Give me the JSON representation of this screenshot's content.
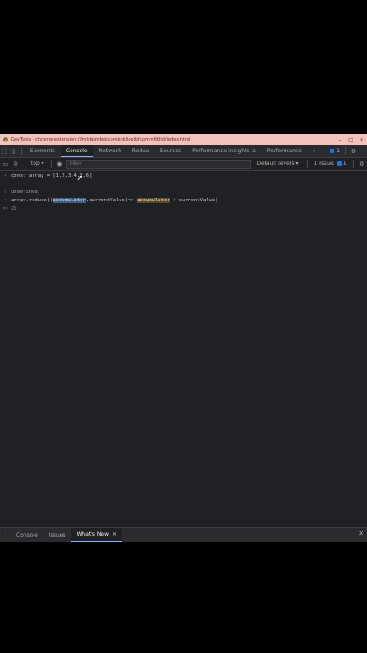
{
  "window": {
    "title": "DevTools - chrome-extension://lmhkpmbekcpmknklioeibfkpmmfibljd/index.html",
    "minimize": "–",
    "maximize": "□",
    "close": "✕"
  },
  "tabs": [
    {
      "label": "Elements"
    },
    {
      "label": "Console"
    },
    {
      "label": "Network"
    },
    {
      "label": "Redux"
    },
    {
      "label": "Sources"
    },
    {
      "label": "Performance insights ⚠"
    },
    {
      "label": "Performance"
    }
  ],
  "more_tabs": "»",
  "message_badge": "1",
  "toolbar": {
    "context": "top ▾",
    "filter_placeholder": "Filter",
    "levels": "Default levels ▾",
    "issues": "1 Issue:",
    "issues_count": "1"
  },
  "console": {
    "line1_input": "const array = [1,2,3,4,5,6]",
    "line2_output": "undefined",
    "line3_pre": "array.reduce((",
    "line3_hl1": "accumulator",
    "line3_mid": ",currentValue)=> ",
    "line3_hl2": "accumulator",
    "line3_post": " + currentValue)",
    "line4_eager": "21"
  },
  "drawer": {
    "tabs": [
      {
        "label": "Console"
      },
      {
        "label": "Issues"
      },
      {
        "label": "What's New"
      }
    ]
  }
}
